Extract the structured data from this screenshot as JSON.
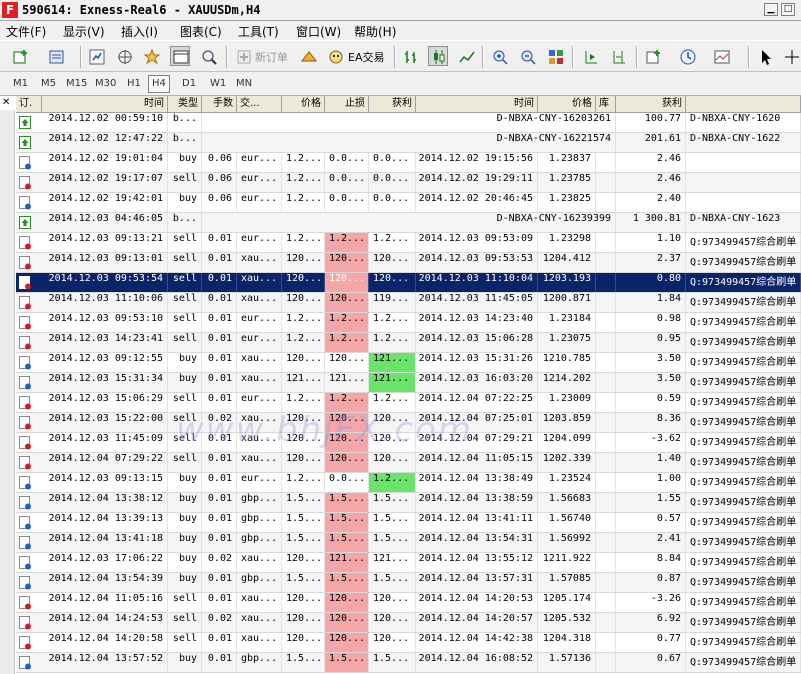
{
  "window": {
    "title": "590614: Exness-Real6 - XAUUSDm,H4",
    "app_icon": "F"
  },
  "menu": [
    "文件(F)",
    "显示(V)",
    "插入(I)",
    "图表(C)",
    "工具(T)",
    "窗口(W)",
    "帮助(H)"
  ],
  "toolbar": {
    "new_order_label": "新订单",
    "expert_label": "EA交易"
  },
  "timeframes": [
    "M1",
    "M5",
    "M15",
    "M30",
    "H1",
    "H4",
    "D1",
    "W1",
    "MN"
  ],
  "active_timeframe": "H4",
  "watermark": "www.bhjFX.com",
  "columns": [
    "订.",
    "时间",
    "类型",
    "手数",
    "交...",
    "价格",
    "止损",
    "获利",
    "时间",
    "价格",
    "库",
    "获利",
    ""
  ],
  "rows": [
    {
      "icon": "balance",
      "open": "2014.12.02 00:59:10",
      "type": "b...",
      "lots": "",
      "sym": "",
      "price": "",
      "sl": "",
      "tp": "",
      "close": "",
      "cprice": "",
      "comment_id": "D-NBXA-CNY-16203261",
      "profit": "100.77",
      "comment": "D-NBXA-CNY-1620",
      "bal": true
    },
    {
      "icon": "balance",
      "open": "2014.12.02 12:47:22",
      "type": "b...",
      "lots": "",
      "sym": "",
      "price": "",
      "sl": "",
      "tp": "",
      "close": "",
      "cprice": "",
      "comment_id": "D-NBXA-CNY-16221574",
      "profit": "201.61",
      "comment": "D-NBXA-CNY-1622",
      "bal": true
    },
    {
      "icon": "buy",
      "open": "2014.12.02 19:01:04",
      "type": "buy",
      "lots": "0.06",
      "sym": "eur...",
      "price": "1.2...",
      "sl": "0.0...",
      "tp": "0.0...",
      "close": "2014.12.02 19:15:56",
      "cprice": "1.23837",
      "profit": "2.46",
      "comment": ""
    },
    {
      "icon": "sell",
      "open": "2014.12.02 19:17:07",
      "type": "sell",
      "lots": "0.06",
      "sym": "eur...",
      "price": "1.2...",
      "sl": "0.0...",
      "tp": "0.0...",
      "close": "2014.12.02 19:29:11",
      "cprice": "1.23785",
      "profit": "2.46",
      "comment": ""
    },
    {
      "icon": "buy",
      "open": "2014.12.02 19:42:01",
      "type": "buy",
      "lots": "0.06",
      "sym": "eur...",
      "price": "1.2...",
      "sl": "0.0...",
      "tp": "0.0...",
      "close": "2014.12.02 20:46:45",
      "cprice": "1.23825",
      "profit": "2.40",
      "comment": ""
    },
    {
      "icon": "balance",
      "open": "2014.12.03 04:46:05",
      "type": "b...",
      "lots": "",
      "sym": "",
      "price": "",
      "sl": "",
      "tp": "",
      "close": "",
      "cprice": "",
      "comment_id": "D-NBXA-CNY-16239399",
      "profit": "1 300.81",
      "comment": "D-NBXA-CNY-1623",
      "bal": true
    },
    {
      "icon": "sell",
      "open": "2014.12.03 09:13:21",
      "type": "sell",
      "lots": "0.01",
      "sym": "eur...",
      "price": "1.2...",
      "sl": "1.2...",
      "tp": "1.2...",
      "close": "2014.12.03 09:53:09",
      "cprice": "1.23298",
      "profit": "1.10",
      "comment": "Q:973499457综合刷单",
      "slc": "red"
    },
    {
      "icon": "sell",
      "open": "2014.12.03 09:13:01",
      "type": "sell",
      "lots": "0.01",
      "sym": "xau...",
      "price": "120...",
      "sl": "120...",
      "tp": "120...",
      "close": "2014.12.03 09:53:53",
      "cprice": "1204.412",
      "profit": "2.37",
      "comment": "Q:973499457综合刷单",
      "slc": "red"
    },
    {
      "icon": "sell",
      "open": "2014.12.03 09:53:54",
      "type": "sell",
      "lots": "0.01",
      "sym": "xau...",
      "price": "120...",
      "sl": "120...",
      "tp": "120...",
      "close": "2014.12.03 11:10:04",
      "cprice": "1203.193",
      "profit": "0.80",
      "comment": "Q:973499457综合刷单",
      "slc": "red",
      "selected": true
    },
    {
      "icon": "sell",
      "open": "2014.12.03 11:10:06",
      "type": "sell",
      "lots": "0.01",
      "sym": "xau...",
      "price": "120...",
      "sl": "120...",
      "tp": "119...",
      "close": "2014.12.03 11:45:05",
      "cprice": "1200.871",
      "profit": "1.84",
      "comment": "Q:973499457综合刷单",
      "slc": "red"
    },
    {
      "icon": "sell",
      "open": "2014.12.03 09:53:10",
      "type": "sell",
      "lots": "0.01",
      "sym": "eur...",
      "price": "1.2...",
      "sl": "1.2...",
      "tp": "1.2...",
      "close": "2014.12.03 14:23:40",
      "cprice": "1.23184",
      "profit": "0.98",
      "comment": "Q:973499457综合刷单",
      "slc": "red"
    },
    {
      "icon": "sell",
      "open": "2014.12.03 14:23:41",
      "type": "sell",
      "lots": "0.01",
      "sym": "eur...",
      "price": "1.2...",
      "sl": "1.2...",
      "tp": "1.2...",
      "close": "2014.12.03 15:06:28",
      "cprice": "1.23075",
      "profit": "0.95",
      "comment": "Q:973499457综合刷单",
      "slc": "red"
    },
    {
      "icon": "buy",
      "open": "2014.12.03 09:12:55",
      "type": "buy",
      "lots": "0.01",
      "sym": "xau...",
      "price": "120...",
      "sl": "120...",
      "tp": "121...",
      "close": "2014.12.03 15:31:26",
      "cprice": "1210.785",
      "profit": "3.50",
      "comment": "Q:973499457综合刷单",
      "tpc": "green"
    },
    {
      "icon": "buy",
      "open": "2014.12.03 15:31:34",
      "type": "buy",
      "lots": "0.01",
      "sym": "xau...",
      "price": "121...",
      "sl": "121...",
      "tp": "121...",
      "close": "2014.12.03 16:03:20",
      "cprice": "1214.202",
      "profit": "3.50",
      "comment": "Q:973499457综合刷单",
      "tpc": "green"
    },
    {
      "icon": "sell",
      "open": "2014.12.03 15:06:29",
      "type": "sell",
      "lots": "0.01",
      "sym": "eur...",
      "price": "1.2...",
      "sl": "1.2...",
      "tp": "1.2...",
      "close": "2014.12.04 07:22:25",
      "cprice": "1.23009",
      "profit": "0.59",
      "comment": "Q:973499457综合刷单",
      "slc": "red"
    },
    {
      "icon": "sell",
      "open": "2014.12.03 15:22:00",
      "type": "sell",
      "lots": "0.02",
      "sym": "xau...",
      "price": "120...",
      "sl": "120...",
      "tp": "120...",
      "close": "2014.12.04 07:25:01",
      "cprice": "1203.859",
      "profit": "8.36",
      "comment": "Q:973499457综合刷单",
      "slc": "red"
    },
    {
      "icon": "sell",
      "open": "2014.12.03 11:45:09",
      "type": "sell",
      "lots": "0.01",
      "sym": "xau...",
      "price": "120...",
      "sl": "120...",
      "tp": "120...",
      "close": "2014.12.04 07:29:21",
      "cprice": "1204.099",
      "profit": "-3.62",
      "comment": "Q:973499457综合刷单",
      "slc": "red"
    },
    {
      "icon": "sell",
      "open": "2014.12.04 07:29:22",
      "type": "sell",
      "lots": "0.01",
      "sym": "xau...",
      "price": "120...",
      "sl": "120...",
      "tp": "120...",
      "close": "2014.12.04 11:05:15",
      "cprice": "1202.339",
      "profit": "1.40",
      "comment": "Q:973499457综合刷单",
      "slc": "red"
    },
    {
      "icon": "buy",
      "open": "2014.12.03 09:13:15",
      "type": "buy",
      "lots": "0.01",
      "sym": "eur...",
      "price": "1.2...",
      "sl": "0.0...",
      "tp": "1.2...",
      "close": "2014.12.04 13:38:49",
      "cprice": "1.23524",
      "profit": "1.00",
      "comment": "Q:973499457综合刷单",
      "tpc": "green"
    },
    {
      "icon": "buy",
      "open": "2014.12.04 13:38:12",
      "type": "buy",
      "lots": "0.01",
      "sym": "gbp...",
      "price": "1.5...",
      "sl": "1.5...",
      "tp": "1.5...",
      "close": "2014.12.04 13:38:59",
      "cprice": "1.56683",
      "profit": "1.55",
      "comment": "Q:973499457综合刷单",
      "slc": "red"
    },
    {
      "icon": "buy",
      "open": "2014.12.04 13:39:13",
      "type": "buy",
      "lots": "0.01",
      "sym": "gbp...",
      "price": "1.5...",
      "sl": "1.5...",
      "tp": "1.5...",
      "close": "2014.12.04 13:41:11",
      "cprice": "1.56740",
      "profit": "0.57",
      "comment": "Q:973499457综合刷单",
      "slc": "red"
    },
    {
      "icon": "buy",
      "open": "2014.12.04 13:41:18",
      "type": "buy",
      "lots": "0.01",
      "sym": "gbp...",
      "price": "1.5...",
      "sl": "1.5...",
      "tp": "1.5...",
      "close": "2014.12.04 13:54:31",
      "cprice": "1.56992",
      "profit": "2.41",
      "comment": "Q:973499457综合刷单",
      "slc": "red"
    },
    {
      "icon": "buy",
      "open": "2014.12.03 17:06:22",
      "type": "buy",
      "lots": "0.02",
      "sym": "xau...",
      "price": "120...",
      "sl": "121...",
      "tp": "121...",
      "close": "2014.12.04 13:55:12",
      "cprice": "1211.922",
      "profit": "8.84",
      "comment": "Q:973499457综合刷单",
      "slc": "red"
    },
    {
      "icon": "buy",
      "open": "2014.12.04 13:54:39",
      "type": "buy",
      "lots": "0.01",
      "sym": "gbp...",
      "price": "1.5...",
      "sl": "1.5...",
      "tp": "1.5...",
      "close": "2014.12.04 13:57:31",
      "cprice": "1.57085",
      "profit": "0.87",
      "comment": "Q:973499457综合刷单",
      "slc": "red"
    },
    {
      "icon": "sell",
      "open": "2014.12.04 11:05:16",
      "type": "sell",
      "lots": "0.01",
      "sym": "xau...",
      "price": "120...",
      "sl": "120...",
      "tp": "120...",
      "close": "2014.12.04 14:20:53",
      "cprice": "1205.174",
      "profit": "-3.26",
      "comment": "Q:973499457综合刷单",
      "slc": "red"
    },
    {
      "icon": "sell",
      "open": "2014.12.04 14:24:53",
      "type": "sell",
      "lots": "0.02",
      "sym": "xau...",
      "price": "120...",
      "sl": "120...",
      "tp": "120...",
      "close": "2014.12.04 14:20:57",
      "cprice": "1205.532",
      "profit": "6.92",
      "comment": "Q:973499457综合刷单",
      "slc": "red"
    },
    {
      "icon": "sell",
      "open": "2014.12.04 14:20:58",
      "type": "sell",
      "lots": "0.01",
      "sym": "xau...",
      "price": "120...",
      "sl": "120...",
      "tp": "120...",
      "close": "2014.12.04 14:42:38",
      "cprice": "1204.318",
      "profit": "0.77",
      "comment": "Q:973499457综合刷单",
      "slc": "red"
    },
    {
      "icon": "buy",
      "open": "2014.12.04 13:57:52",
      "type": "buy",
      "lots": "0.01",
      "sym": "gbp...",
      "price": "1.5...",
      "sl": "1.5...",
      "tp": "1.5...",
      "close": "2014.12.04 16:08:52",
      "cprice": "1.57136",
      "profit": "0.67",
      "comment": "Q:973499457综合刷单",
      "slc": "red"
    }
  ],
  "colors": {
    "selected_row": "#0a246a",
    "stop_loss_hit": "#f5a7a7",
    "take_profit_hit": "#6ae46a",
    "header_bg": "#ece9d8"
  }
}
